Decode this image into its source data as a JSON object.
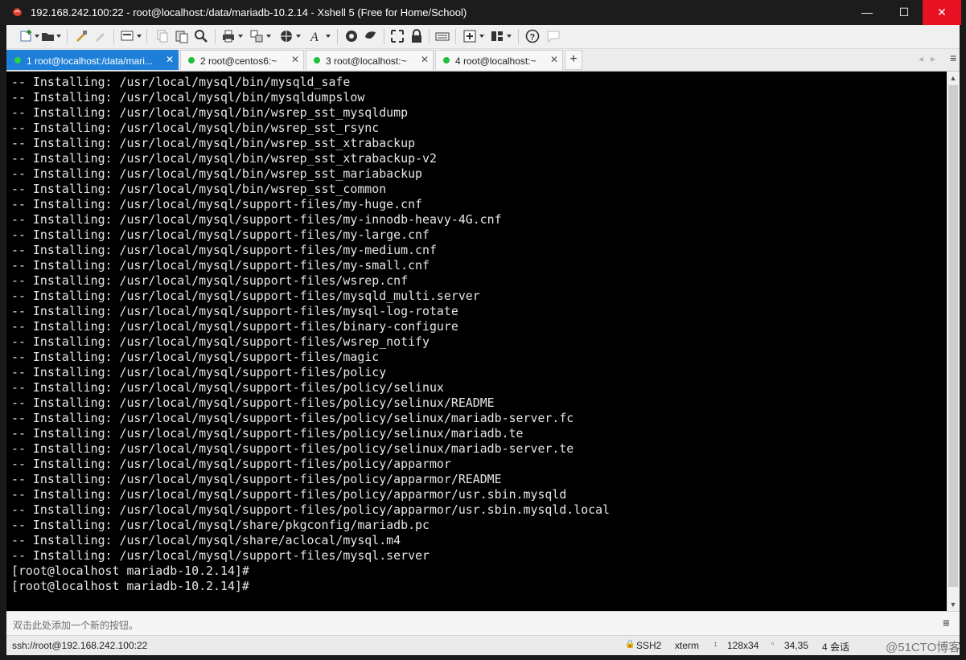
{
  "window": {
    "title": "192.168.242.100:22 - root@localhost:/data/mariadb-10.2.14 - Xshell 5 (Free for Home/School)",
    "minimize": "—",
    "maximize": "☐",
    "close": "✕"
  },
  "tabs": [
    {
      "label": "1 root@localhost:/data/mari...",
      "close": "✕",
      "active": true
    },
    {
      "label": "2 root@centos6:~",
      "close": "✕",
      "active": false
    },
    {
      "label": "3 root@localhost:~",
      "close": "✕",
      "active": false
    },
    {
      "label": "4 root@localhost:~",
      "close": "✕",
      "active": false
    }
  ],
  "tab_add": "+",
  "tab_nav": {
    "prev": "◂",
    "next": "▸",
    "menu": "≡"
  },
  "terminal": {
    "lines": [
      "-- Installing: /usr/local/mysql/bin/mysqld_safe",
      "-- Installing: /usr/local/mysql/bin/mysqldumpslow",
      "-- Installing: /usr/local/mysql/bin/wsrep_sst_mysqldump",
      "-- Installing: /usr/local/mysql/bin/wsrep_sst_rsync",
      "-- Installing: /usr/local/mysql/bin/wsrep_sst_xtrabackup",
      "-- Installing: /usr/local/mysql/bin/wsrep_sst_xtrabackup-v2",
      "-- Installing: /usr/local/mysql/bin/wsrep_sst_mariabackup",
      "-- Installing: /usr/local/mysql/bin/wsrep_sst_common",
      "-- Installing: /usr/local/mysql/support-files/my-huge.cnf",
      "-- Installing: /usr/local/mysql/support-files/my-innodb-heavy-4G.cnf",
      "-- Installing: /usr/local/mysql/support-files/my-large.cnf",
      "-- Installing: /usr/local/mysql/support-files/my-medium.cnf",
      "-- Installing: /usr/local/mysql/support-files/my-small.cnf",
      "-- Installing: /usr/local/mysql/support-files/wsrep.cnf",
      "-- Installing: /usr/local/mysql/support-files/mysqld_multi.server",
      "-- Installing: /usr/local/mysql/support-files/mysql-log-rotate",
      "-- Installing: /usr/local/mysql/support-files/binary-configure",
      "-- Installing: /usr/local/mysql/support-files/wsrep_notify",
      "-- Installing: /usr/local/mysql/support-files/magic",
      "-- Installing: /usr/local/mysql/support-files/policy",
      "-- Installing: /usr/local/mysql/support-files/policy/selinux",
      "-- Installing: /usr/local/mysql/support-files/policy/selinux/README",
      "-- Installing: /usr/local/mysql/support-files/policy/selinux/mariadb-server.fc",
      "-- Installing: /usr/local/mysql/support-files/policy/selinux/mariadb.te",
      "-- Installing: /usr/local/mysql/support-files/policy/selinux/mariadb-server.te",
      "-- Installing: /usr/local/mysql/support-files/policy/apparmor",
      "-- Installing: /usr/local/mysql/support-files/policy/apparmor/README",
      "-- Installing: /usr/local/mysql/support-files/policy/apparmor/usr.sbin.mysqld",
      "-- Installing: /usr/local/mysql/support-files/policy/apparmor/usr.sbin.mysqld.local",
      "-- Installing: /usr/local/mysql/share/pkgconfig/mariadb.pc",
      "-- Installing: /usr/local/mysql/share/aclocal/mysql.m4",
      "-- Installing: /usr/local/mysql/support-files/mysql.server",
      "[root@localhost mariadb-10.2.14]#",
      "[root@localhost mariadb-10.2.14]#"
    ]
  },
  "compose_bar": {
    "hint": "双击此处添加一个新的按钮。",
    "menu_icon": "≡"
  },
  "status_bar": {
    "connection": "ssh://root@192.168.242.100:22",
    "protocol": "SSH2",
    "terminal_type": "xterm",
    "size": "128x34",
    "cursor": "34,35",
    "sessions": "4 会话",
    "watermark": "@51CTO博客"
  },
  "colors": {
    "titlebar_bg": "#1c1c1c",
    "close_button": "#e81123",
    "active_tab": "#1e7fd9",
    "status_dot": "#1fbf3a",
    "terminal_bg": "#000000",
    "terminal_fg": "#e6e6e6"
  },
  "toolbar_icons": [
    "new-session-icon",
    "open-folder-icon",
    "reconnect-icon",
    "disconnect-icon",
    "properties-icon",
    "copy-icon",
    "paste-icon",
    "find-icon",
    "print-icon",
    "transfer-icon",
    "globe-icon",
    "font-icon",
    "xftp-icon",
    "xmanager-icon",
    "fullscreen-icon",
    "lock-icon",
    "keyboard-icon",
    "add-button-icon",
    "layout-icon",
    "help-icon",
    "chat-icon"
  ]
}
